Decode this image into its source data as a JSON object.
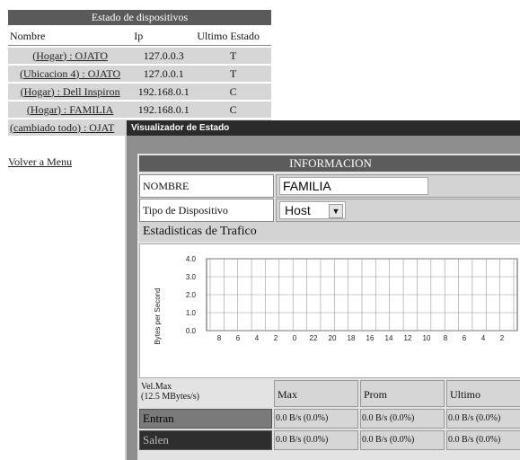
{
  "devices_panel": {
    "title": "Estado de dispositivos",
    "columns": [
      "Nombre",
      "Ip",
      "Ultimo Estado"
    ],
    "rows": [
      {
        "name": "(Hogar) : OJATO",
        "ip": "127.0.0.3",
        "status": "T"
      },
      {
        "name": "(Ubicacion 4) : OJATO",
        "ip": "127.0.0.1",
        "status": "T"
      },
      {
        "name": "(Hogar) : Dell Inspiron",
        "ip": "192.168.0.1",
        "status": "C"
      },
      {
        "name": "(Hogar) : FAMILIA",
        "ip": "192.168.0.1",
        "status": "C"
      }
    ],
    "extra_link": "(cambiado todo) : OJAT",
    "back_link": "Volver a Menu"
  },
  "popup": {
    "title": "Visualizador de Estado",
    "info_heading": "INFORMACION",
    "nombre_label": "NOMBRE",
    "nombre_value": "FAMILIA",
    "tipo_label": "Tipo de Dispositivo",
    "tipo_value": "Host",
    "stats_heading": "Estadisticas de Trafico",
    "legend_label_line1": "Vel.Max",
    "legend_label_line2": "(12.5 MBytes/s)",
    "col_max": "Max",
    "col_prom": "Prom",
    "col_ultimo": "Ultimo",
    "entran_label": "Entran",
    "salen_label": "Salen",
    "entran_values": [
      "0.0 B/s (0.0%)",
      "0.0 B/s (0.0%)",
      "0.0 B/s (0.0%)"
    ],
    "salen_values": [
      "0.0 B/s (0.0%)",
      "0.0 B/s (0.0%)",
      "0.0 B/s (0.0%)"
    ],
    "entran_color": "#7a7a7a",
    "salen_color": "#2e2e2e"
  },
  "chart_data": {
    "type": "line",
    "ylabel": "Bytes per Second",
    "ylim": [
      0,
      4
    ],
    "yticks": [
      "0.0",
      "1.0",
      "2.0",
      "3.0",
      "4.0"
    ],
    "xticks": [
      "8",
      "6",
      "4",
      "2",
      "0",
      "22",
      "20",
      "18",
      "16",
      "14",
      "12",
      "10",
      "8",
      "6",
      "4",
      "2"
    ],
    "series": [],
    "grid": true
  }
}
